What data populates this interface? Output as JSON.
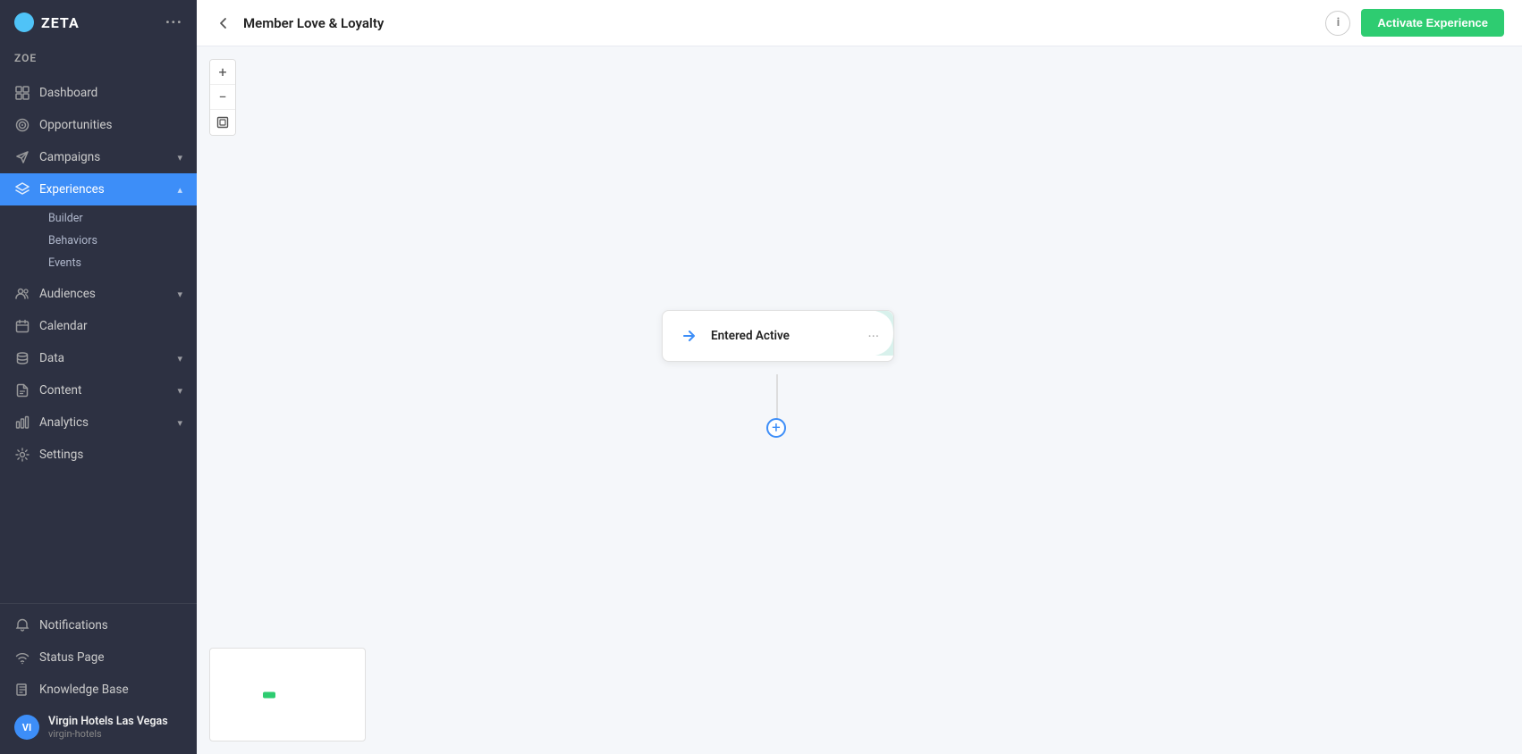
{
  "app": {
    "logo": "ZETA",
    "logo_icon": "Z"
  },
  "sidebar": {
    "dots_label": "···",
    "zoe_label": "ZOE",
    "items": [
      {
        "id": "dashboard",
        "label": "Dashboard",
        "icon": "grid",
        "active": false,
        "has_chevron": false
      },
      {
        "id": "opportunities",
        "label": "Opportunities",
        "icon": "target",
        "active": false,
        "has_chevron": false
      },
      {
        "id": "campaigns",
        "label": "Campaigns",
        "icon": "send",
        "active": false,
        "has_chevron": true
      },
      {
        "id": "experiences",
        "label": "Experiences",
        "icon": "layers",
        "active": true,
        "has_chevron": true
      },
      {
        "id": "audiences",
        "label": "Audiences",
        "icon": "users",
        "active": false,
        "has_chevron": true
      },
      {
        "id": "calendar",
        "label": "Calendar",
        "icon": "calendar",
        "active": false,
        "has_chevron": false
      },
      {
        "id": "data",
        "label": "Data",
        "icon": "database",
        "active": false,
        "has_chevron": true
      },
      {
        "id": "content",
        "label": "Content",
        "icon": "file",
        "active": false,
        "has_chevron": true
      },
      {
        "id": "analytics",
        "label": "Analytics",
        "icon": "bar-chart",
        "active": false,
        "has_chevron": true
      },
      {
        "id": "settings",
        "label": "Settings",
        "icon": "settings",
        "active": false,
        "has_chevron": false
      }
    ],
    "sub_items": {
      "experiences": [
        "Builder",
        "Behaviors",
        "Events"
      ]
    },
    "bottom_items": [
      {
        "id": "notifications",
        "label": "Notifications",
        "icon": "bell"
      },
      {
        "id": "status-page",
        "label": "Status Page",
        "icon": "wifi"
      },
      {
        "id": "knowledge-base",
        "label": "Knowledge Base",
        "icon": "book"
      }
    ],
    "user": {
      "initials": "VI",
      "name": "Virgin Hotels Las Vegas",
      "sub": "virgin-hotels"
    }
  },
  "topbar": {
    "back_icon": "‹",
    "title": "Member Love & Loyalty",
    "info_icon": "i",
    "activate_btn_label": "Activate Experience"
  },
  "canvas": {
    "controls": {
      "zoom_in": "+",
      "zoom_out": "−",
      "fit": "⬜"
    },
    "node": {
      "label": "Entered Active",
      "icon": "→",
      "dots": "···"
    },
    "add_btn": "+",
    "minimap": {}
  }
}
